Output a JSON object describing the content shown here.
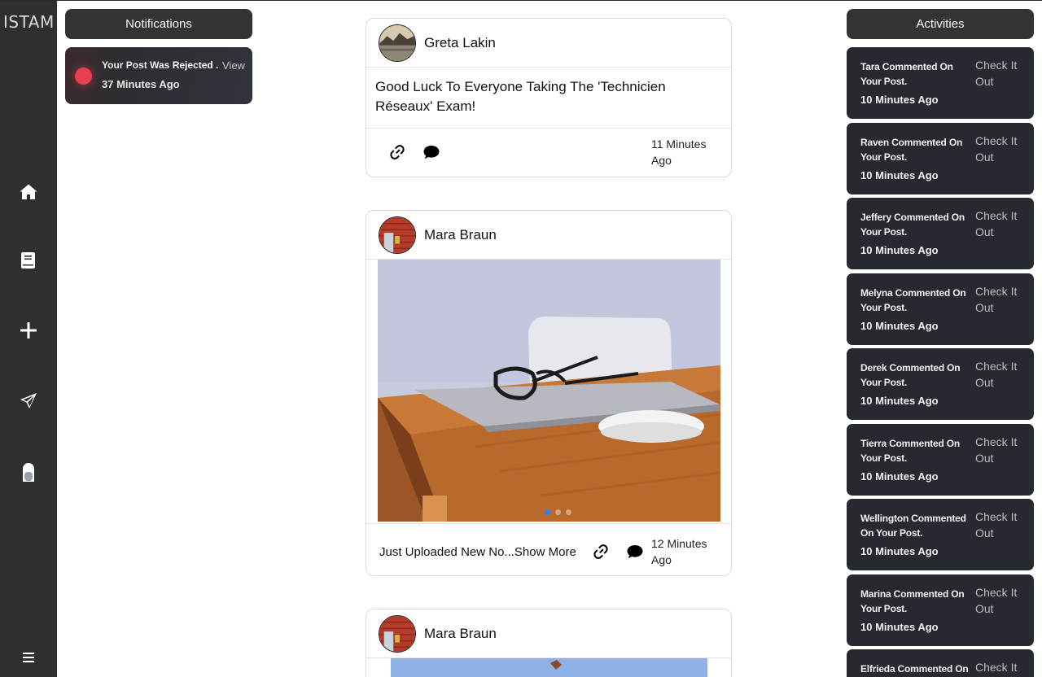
{
  "app": {
    "brand": "ISTAM"
  },
  "sidebar": {
    "items": [
      {
        "name": "home",
        "icon": "home-icon"
      },
      {
        "name": "library",
        "icon": "book-icon"
      },
      {
        "name": "create",
        "icon": "plus-icon"
      },
      {
        "name": "messages",
        "icon": "send-icon"
      },
      {
        "name": "profile",
        "icon": "avatar-icon"
      },
      {
        "name": "menu",
        "icon": "menu-icon"
      }
    ]
  },
  "notifications": {
    "title": "Notifications",
    "items": [
      {
        "text_prefix": "Your Post Was ",
        "text_bold": "Rejected",
        "text_suffix": " .",
        "time": "37 Minutes Ago",
        "action": "View",
        "status_color": "#e8404f"
      }
    ]
  },
  "activities": {
    "title": "Activities",
    "items": [
      {
        "text": "Tara Commented On Your Post.",
        "time": "10 Minutes Ago",
        "action": "Check It Out"
      },
      {
        "text": "Raven Commented On Your Post.",
        "time": "10 Minutes Ago",
        "action": "Check It Out"
      },
      {
        "text": "Jeffery Commented On Your Post.",
        "time": "10 Minutes Ago",
        "action": "Check It Out"
      },
      {
        "text": "Melyna Commented On Your Post.",
        "time": "10 Minutes Ago",
        "action": "Check It Out"
      },
      {
        "text": "Derek Commented On Your Post.",
        "time": "10 Minutes Ago",
        "action": "Check It Out"
      },
      {
        "text": "Tierra Commented On Your Post.",
        "time": "10 Minutes Ago",
        "action": "Check It Out"
      },
      {
        "text": "Wellington Commented On Your Post.",
        "time": "10 Minutes Ago",
        "action": "Check It Out"
      },
      {
        "text": "Marina Commented On Your Post.",
        "time": "10 Minutes Ago",
        "action": "Check It Out"
      },
      {
        "text": "Elfrieda Commented On",
        "time": "",
        "action": "Check It"
      }
    ]
  },
  "feed": {
    "posts": [
      {
        "author": "Greta Lakin",
        "text": "Good Luck To Everyone Taking The 'Technicien Réseaux' Exam!",
        "time": "11 Minutes Ago"
      },
      {
        "author": "Mara Braun",
        "caption": "Just Uploaded New No...",
        "show_more": "Show More",
        "time": "12 Minutes Ago"
      },
      {
        "author": "Mara Braun"
      }
    ]
  },
  "colors": {
    "sidebar": "#2f2f2f",
    "panel_header": "#333333",
    "activity_card": "#262a30",
    "accent_dot": "#1e88ff"
  }
}
